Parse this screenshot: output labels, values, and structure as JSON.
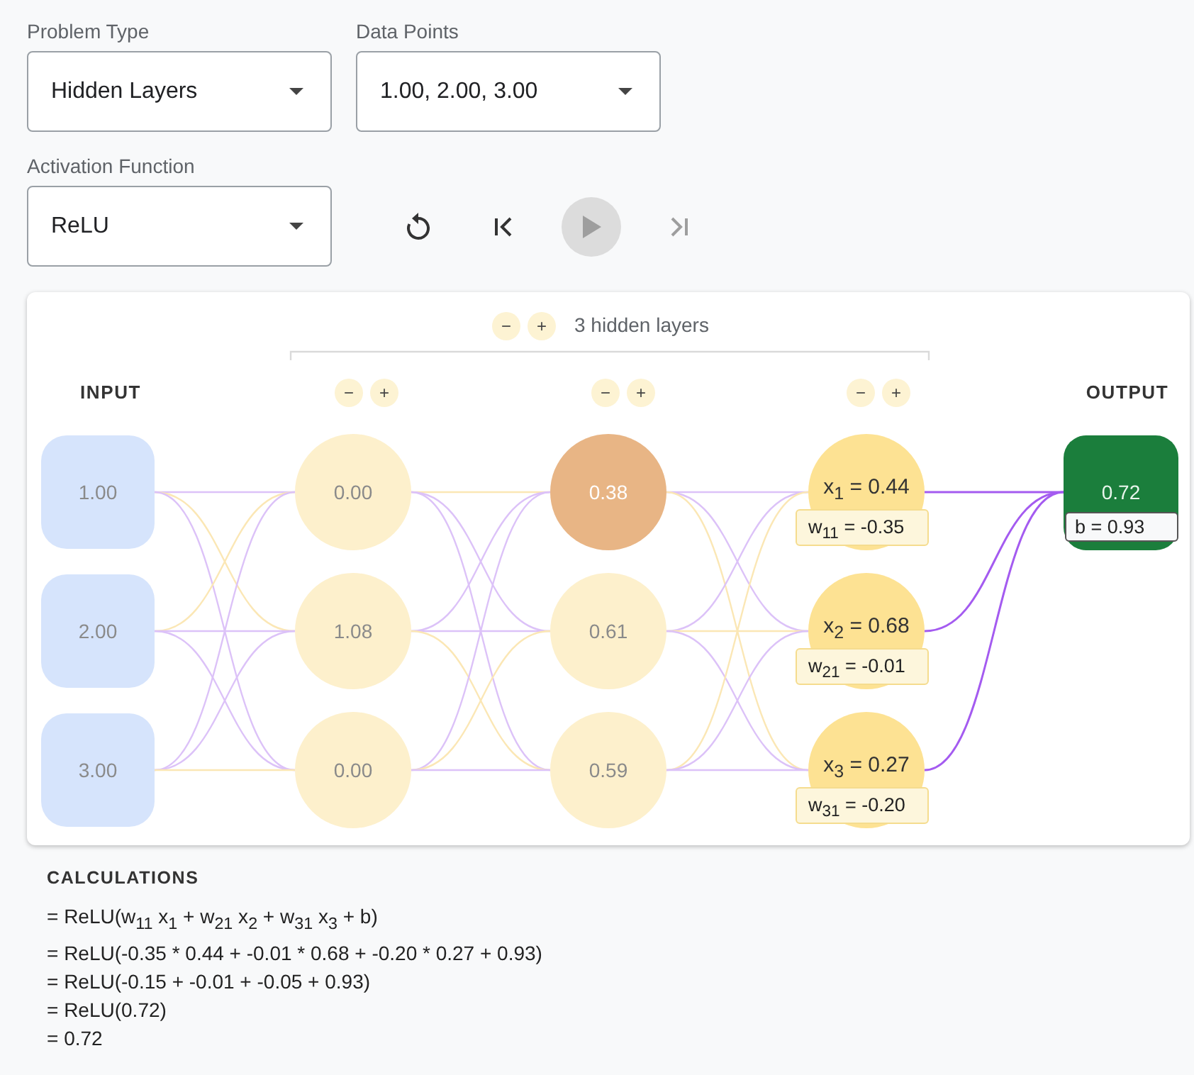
{
  "dropdowns": [
    {
      "label": "Problem Type",
      "value": "Hidden Layers"
    },
    {
      "label": "Data Points",
      "value": "1.00, 2.00, 3.00"
    },
    {
      "label": "Activation Function",
      "value": "ReLU"
    }
  ],
  "playback": [
    {
      "kind": "reset",
      "disabled": false
    },
    {
      "kind": "first",
      "disabled": false
    },
    {
      "kind": "play",
      "disabled": true
    },
    {
      "kind": "next",
      "disabled": true
    }
  ],
  "network": {
    "layers_control": {
      "minus": "−",
      "plus": "+",
      "label": "3 hidden layers"
    },
    "input_label": "INPUT",
    "output_label": "OUTPUT",
    "inputs": [
      {
        "value": "1.00"
      },
      {
        "value": "2.00"
      },
      {
        "value": "3.00"
      }
    ],
    "hidden_layers": [
      {
        "minus": "−",
        "plus": "+",
        "nodes": [
          {
            "value": "0.00",
            "color": "#fdf0cc"
          },
          {
            "value": "1.08",
            "color": "#fdf0cc"
          },
          {
            "value": "0.00",
            "color": "#fdf0cc"
          }
        ]
      },
      {
        "minus": "−",
        "plus": "+",
        "nodes": [
          {
            "value": "0.38",
            "color": "#e8b585"
          },
          {
            "value": "0.61",
            "color": "#fdf0cc"
          },
          {
            "value": "0.59",
            "color": "#fdf0cc"
          }
        ]
      },
      {
        "minus": "−",
        "plus": "+",
        "nodes": [
          {
            "value": "x$_{1}$ = 0.44",
            "weight": "w$_{11}$ = -0.35",
            "color": "#fde293"
          },
          {
            "value": "x$_{2}$ = 0.68",
            "weight": "w$_{21}$ = -0.01",
            "color": "#fde293"
          },
          {
            "value": "x$_{3}$ = 0.27",
            "weight": "w$_{31}$ = -0.20",
            "color": "#fde293"
          }
        ]
      }
    ],
    "output": {
      "value": "0.72",
      "bias": "b = 0.93",
      "color": "#1b7e3c"
    }
  },
  "calculations": {
    "title": "CALCULATIONS",
    "lines": [
      "= ReLU(w$_{11}$ x$_{1}$ + w$_{21}$ x$_{2}$ + w$_{31}$ x$_{3}$ + b)",
      "= ReLU(-0.35 * 0.44 + -0.01 * 0.68 + -0.20 * 0.27 + 0.93)",
      "= ReLU(-0.15 + -0.01 + -0.05 + 0.93)",
      "= ReLU(0.72)",
      "= 0.72"
    ]
  }
}
